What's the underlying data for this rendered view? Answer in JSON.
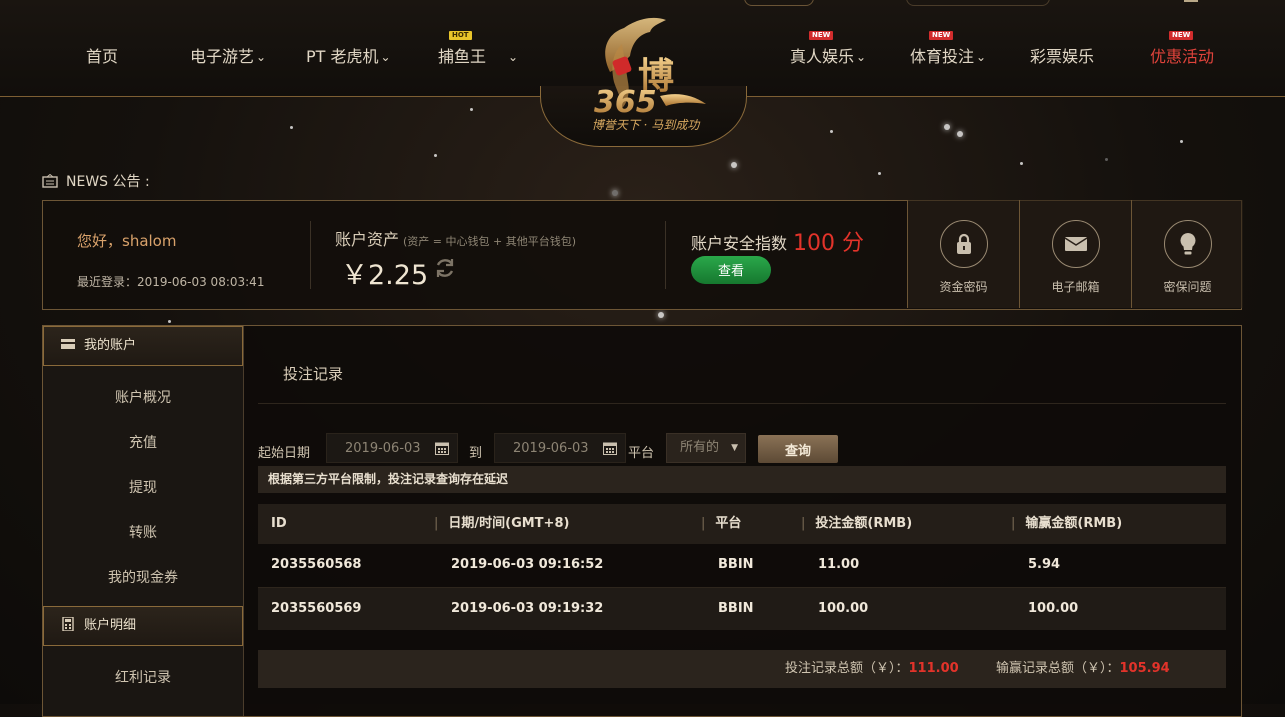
{
  "nav": {
    "left": [
      {
        "label": "首页",
        "chevron": false
      },
      {
        "label": "电子游艺",
        "chevron": true
      },
      {
        "label": "PT 老虎机",
        "chevron": true
      },
      {
        "label": "捕鱼王",
        "chevron": true,
        "badge": "HOT"
      }
    ],
    "right": [
      {
        "label": "真人娱乐",
        "chevron": true,
        "badge": "NEW"
      },
      {
        "label": "体育投注",
        "chevron": true,
        "badge": "NEW"
      },
      {
        "label": "彩票娱乐",
        "chevron": false
      },
      {
        "label": "优惠活动",
        "chevron": false,
        "badge": "NEW",
        "highlight": true
      }
    ],
    "slogan": "博誉天下 · 马到成功"
  },
  "news": {
    "label": "NEWS 公告 :"
  },
  "account": {
    "greeting": "您好，shalom",
    "last_login": "最近登录：2019-06-03 08:03:41",
    "asset_label": "账户资产",
    "asset_note": "(资产 = 中心钱包 + 其他平台钱包)",
    "asset_value": "￥2.25",
    "security_label": "账户安全指数",
    "security_value": "100 分",
    "view_button": "查看",
    "tiles": [
      {
        "label": "资金密码",
        "icon": "lock-icon"
      },
      {
        "label": "电子邮箱",
        "icon": "mail-icon"
      },
      {
        "label": "密保问题",
        "icon": "bulb-icon"
      }
    ]
  },
  "sidebar": {
    "section1": "我的账户",
    "items1": [
      "账户概况",
      "充值",
      "提现",
      "转账",
      "我的现金券"
    ],
    "section2": "账户明细",
    "items2": [
      "红利记录"
    ]
  },
  "main": {
    "title": "投注记录",
    "filter": {
      "start_label": "起始日期",
      "start_date": "2019-06-03",
      "to_label": "到",
      "end_date": "2019-06-03",
      "platform_label": "平台",
      "platform_value": "所有的",
      "query_button": "查询"
    },
    "notice": "根据第三方平台限制，投注记录查询存在延迟",
    "columns": [
      "ID",
      "日期/时间(GMT+8)",
      "平台",
      "投注金额(RMB)",
      "输赢金额(RMB)"
    ],
    "rows": [
      [
        "2035560568",
        "2019-06-03 09:16:52",
        "BBIN",
        "11.00",
        "5.94"
      ],
      [
        "2035560569",
        "2019-06-03 09:19:32",
        "BBIN",
        "100.00",
        "100.00"
      ]
    ],
    "totals": {
      "bet_label": "投注记录总额（￥）：",
      "bet_value": "111.00",
      "win_label": "输赢记录总额（￥）：",
      "win_value": "105.94"
    }
  },
  "colors": {
    "accent": "#e2332a",
    "gold": "#d9a26b",
    "button_green": "#2aa84a"
  }
}
